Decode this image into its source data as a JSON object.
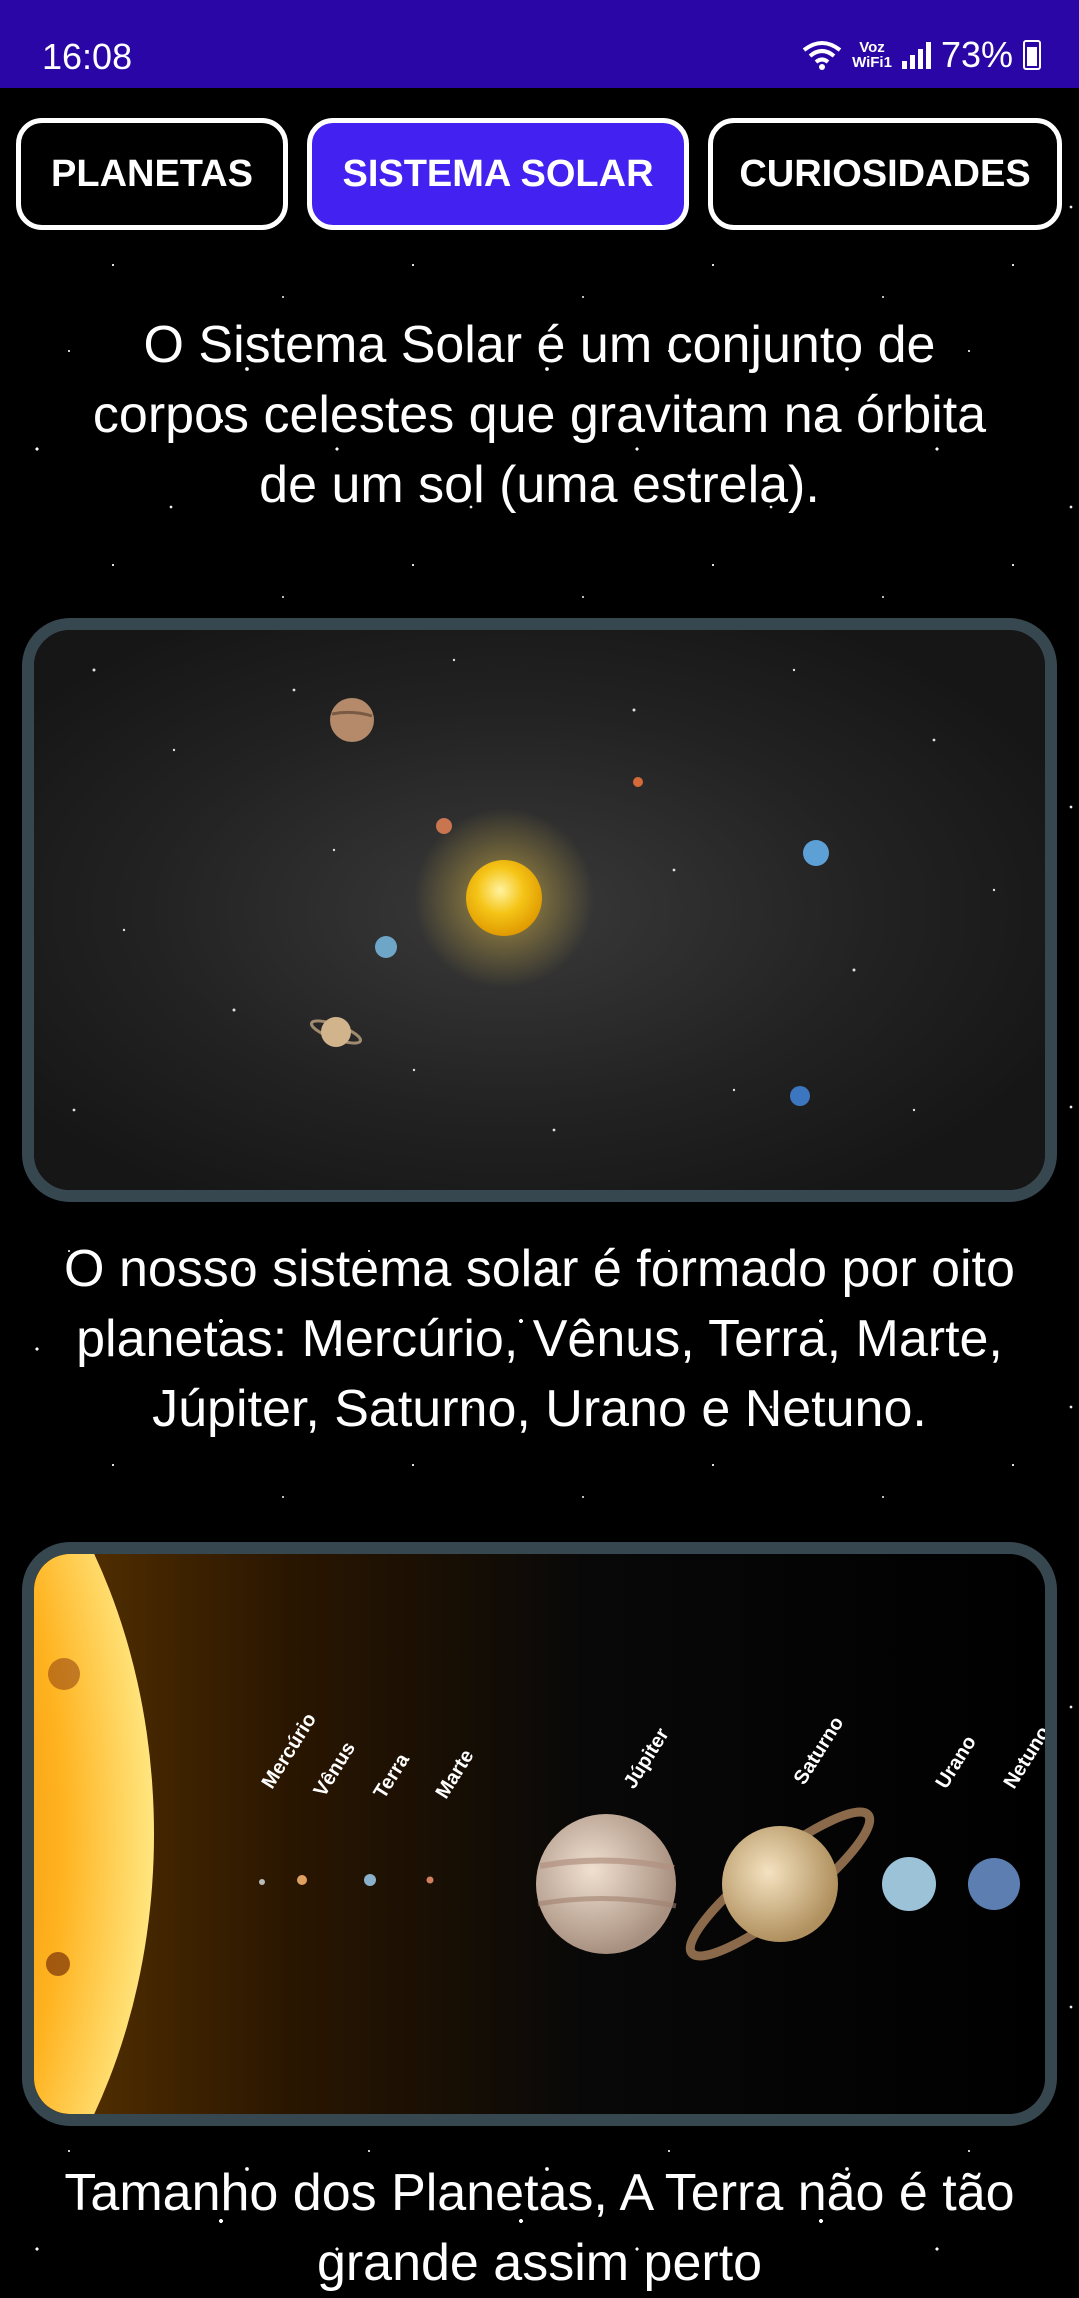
{
  "status": {
    "time": "16:08",
    "vowifi_top": "Voz",
    "vowifi_bottom": "WiFi1",
    "battery": "73%"
  },
  "tabs": [
    {
      "label": "PLANETAS",
      "active": false
    },
    {
      "label": "SISTEMA SOLAR",
      "active": true
    },
    {
      "label": "CURIOSIDADES",
      "active": false
    }
  ],
  "content": {
    "intro": "O Sistema Solar é um conjunto de corpos celestes que gravitam na órbita de um sol (uma estrela).",
    "planets_text": "O nosso sistema solar é formado por oito planetas: Mercúrio, Vênus, Terra, Marte, Júpiter, Saturno, Urano e Netuno.",
    "size_text": "Tamanho dos Planetas, A Terra não é tão grande assim perto"
  },
  "diagram_labels": {
    "mercurio": "Mercúrio",
    "venus": "Vênus",
    "terra": "Terra",
    "marte": "Marte",
    "jupiter": "Júpiter",
    "saturno": "Saturno",
    "urano": "Urano",
    "netuno": "Netuno"
  },
  "colors": {
    "statusbar": "#2a06a6",
    "active_tab": "#4321f0",
    "frame_border": "#37474f"
  }
}
